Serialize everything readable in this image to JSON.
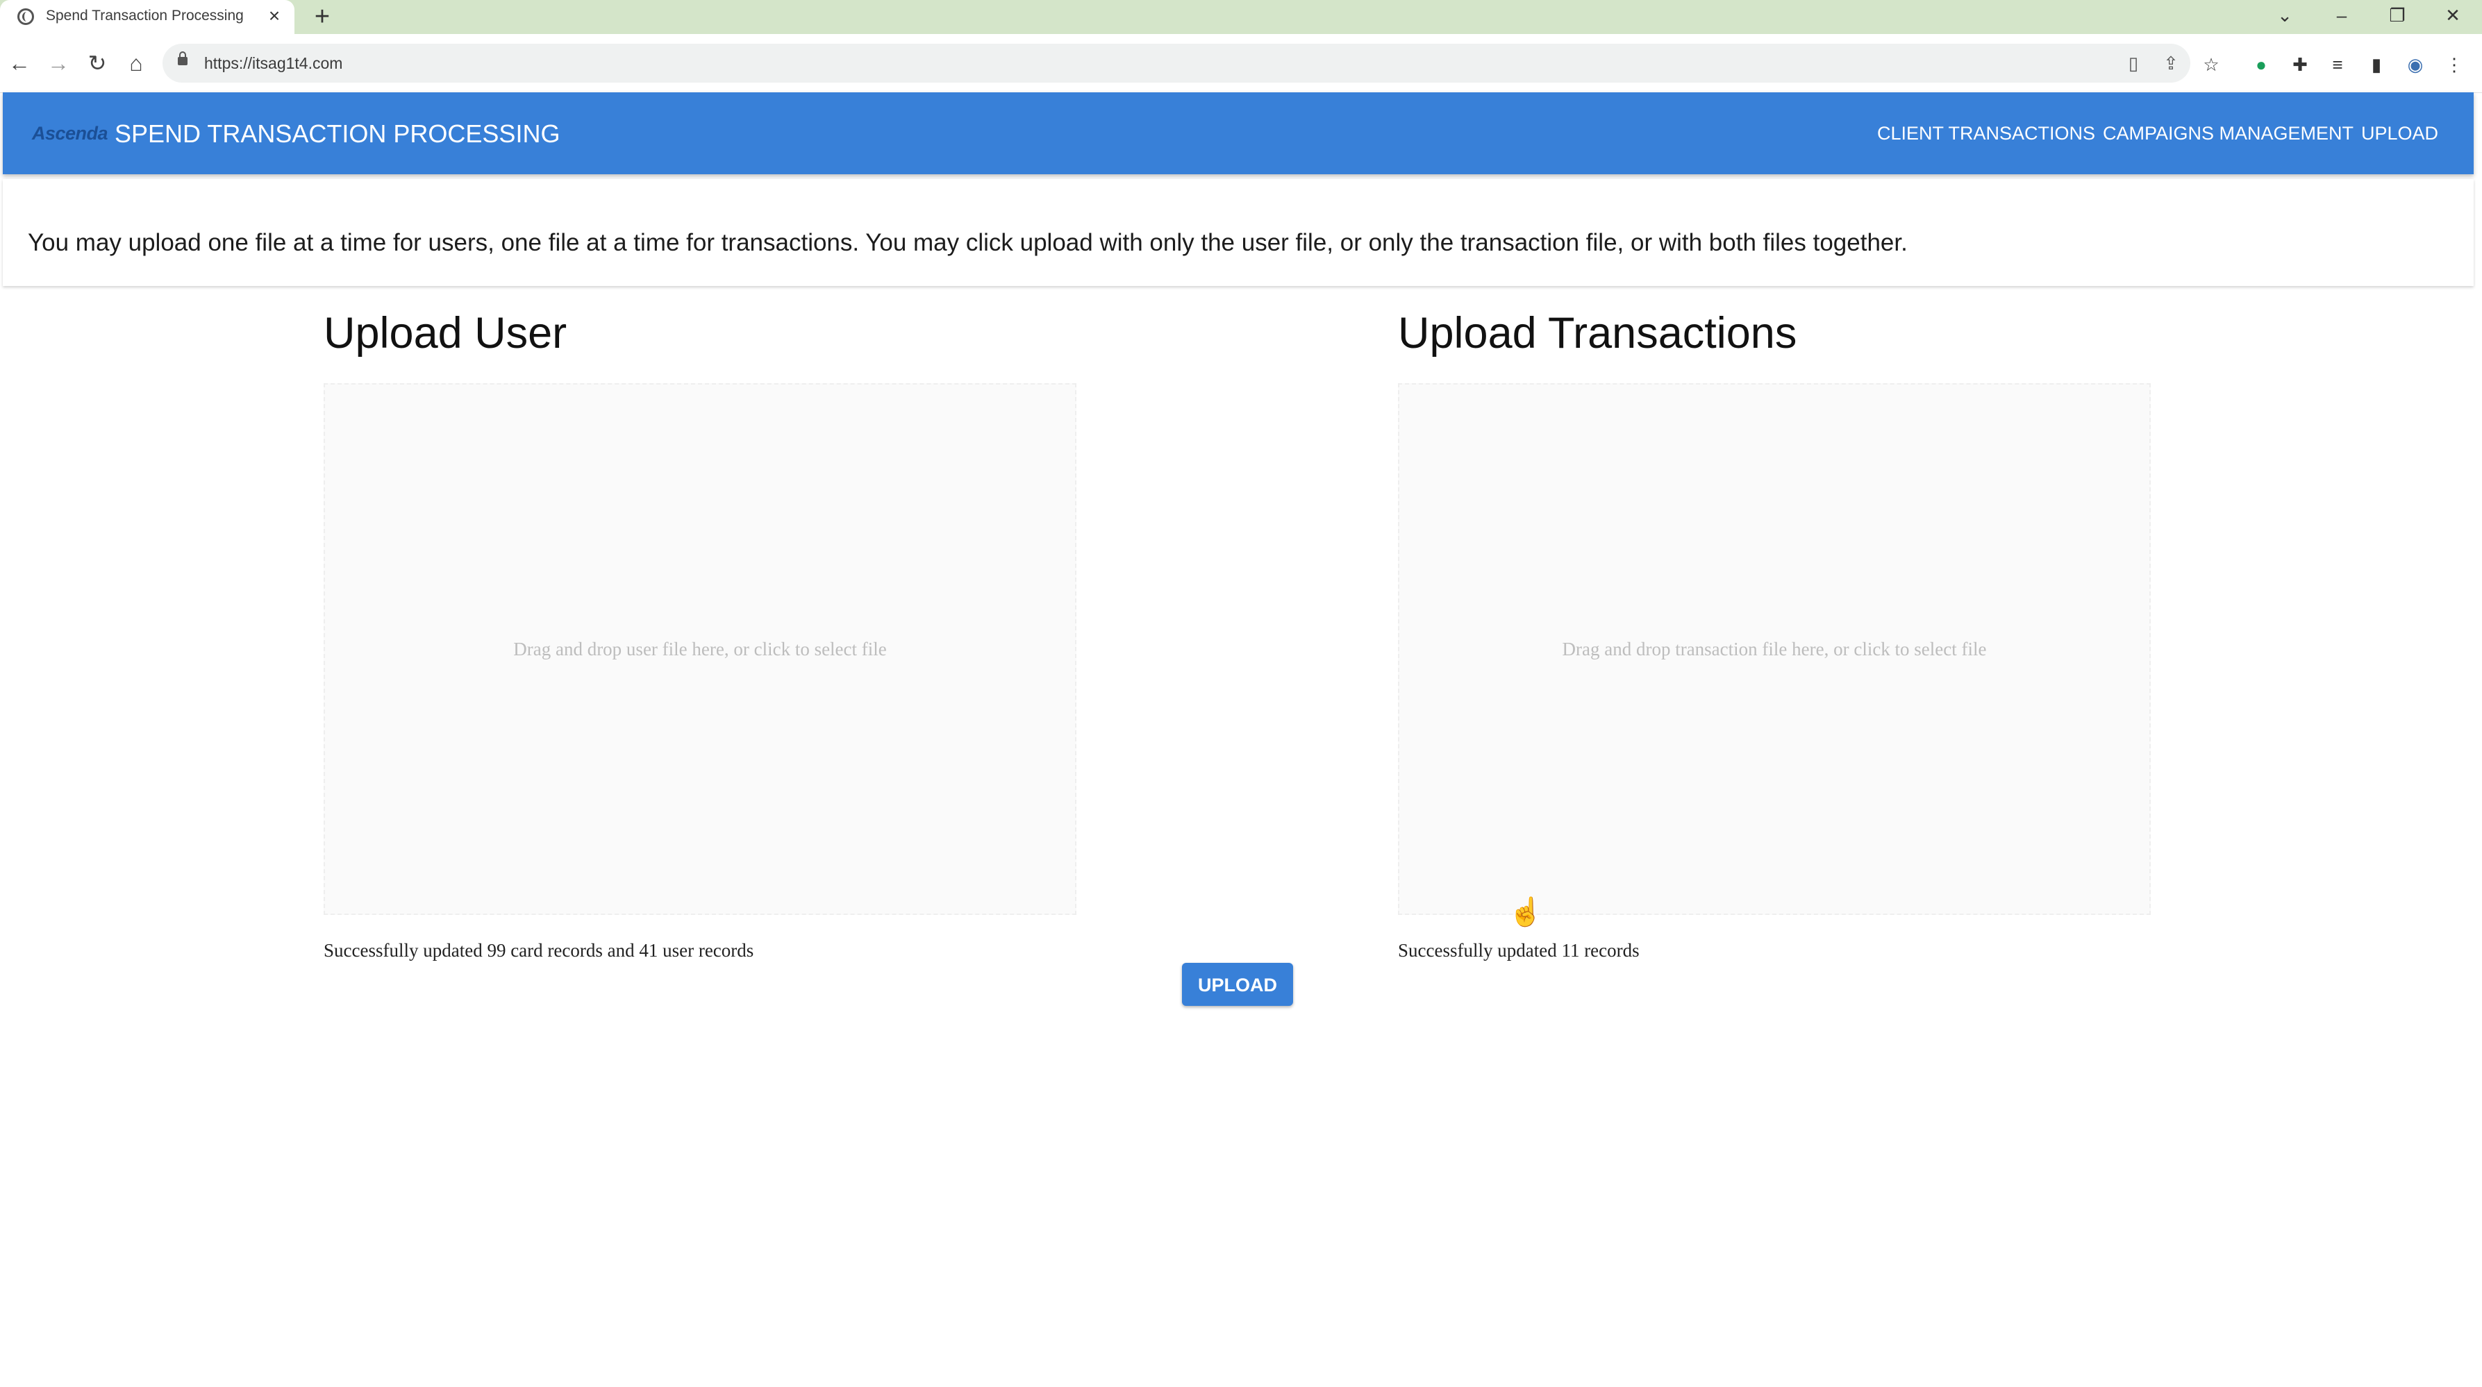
{
  "browser": {
    "tab_title": "Spend Transaction Processing",
    "url": "https://itsag1t4.com"
  },
  "app": {
    "logo_text": "Ascenda",
    "title": "SPEND TRANSACTION PROCESSING",
    "nav": {
      "client_transactions": "CLIENT TRANSACTIONS",
      "campaigns_management": "CAMPAIGNS MANAGEMENT",
      "upload": "UPLOAD"
    },
    "brand_color": "#3880d8"
  },
  "notice": "You may upload one file at a time for users, one file at a time for transactions. You may click upload with only the user file, or only the transaction file, or with both files together.",
  "user_upload": {
    "title": "Upload User",
    "dropzone_text": "Drag and drop user file here, or click to select file",
    "status": "Successfully updated 99 card records and 41 user records"
  },
  "transaction_upload": {
    "title": "Upload Transactions",
    "dropzone_text": "Drag and drop transaction file here, or click to select file",
    "status": "Successfully updated 11 records"
  },
  "upload_button": "UPLOAD"
}
